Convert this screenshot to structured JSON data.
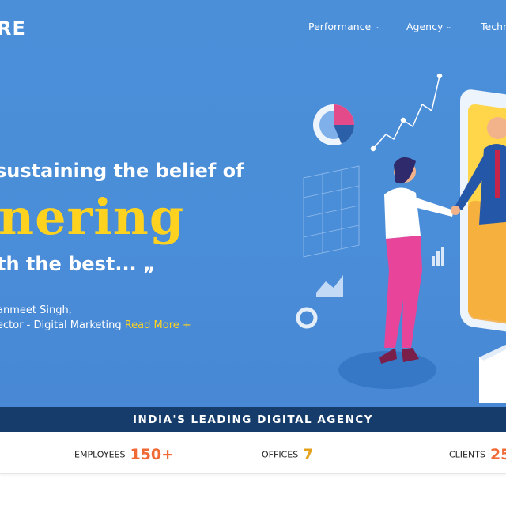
{
  "header": {
    "logo_text": "RE",
    "nav": [
      {
        "label": "Performance",
        "chevron": "⌄"
      },
      {
        "label": "Agency",
        "chevron": "⌄"
      },
      {
        "label": "Techn"
      }
    ]
  },
  "hero": {
    "quote_line1": "sustaining the belief of",
    "quote_highlight": "nering",
    "quote_line3": "th the best... „",
    "author_name": "anmeet Singh,",
    "author_role": "ector - Digital Marketing",
    "read_more": "Read More +"
  },
  "banner": {
    "text": "INDIA'S LEADING DIGITAL AGENCY"
  },
  "stats": [
    {
      "label": "EMPLOYEES",
      "value": "150+"
    },
    {
      "label": "OFFICES",
      "value": "7"
    },
    {
      "label": "CLIENTS",
      "value": "25"
    }
  ],
  "colors": {
    "hero_bg": "#4a8dd8",
    "accent_yellow": "#ffd21f",
    "banner_bg": "#153c6b",
    "stat_orange": "#f06a36",
    "stat_gold": "#e4a11b"
  }
}
